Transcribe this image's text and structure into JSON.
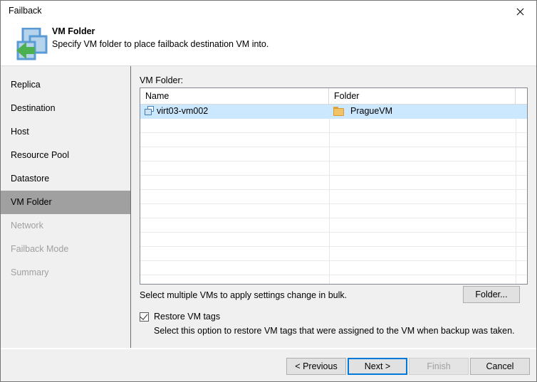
{
  "window": {
    "title": "Failback",
    "close_icon": "close-icon"
  },
  "header": {
    "icon": "failback-vm-folder-icon",
    "title": "VM Folder",
    "subtitle": "Specify VM folder to place failback destination VM into."
  },
  "sidebar": {
    "items": [
      {
        "label": "Replica",
        "state": "enabled"
      },
      {
        "label": "Destination",
        "state": "enabled"
      },
      {
        "label": "Host",
        "state": "enabled"
      },
      {
        "label": "Resource Pool",
        "state": "enabled"
      },
      {
        "label": "Datastore",
        "state": "enabled"
      },
      {
        "label": "VM Folder",
        "state": "selected"
      },
      {
        "label": "Network",
        "state": "disabled"
      },
      {
        "label": "Failback Mode",
        "state": "disabled"
      },
      {
        "label": "Summary",
        "state": "disabled"
      }
    ]
  },
  "main": {
    "list_label": "VM Folder:",
    "grid": {
      "columns": [
        "Name",
        "Folder"
      ],
      "rows": [
        {
          "name": "virt03-vm002",
          "folder": "PragueVM",
          "selected": true
        }
      ],
      "empty_row_count": 12
    },
    "hint": "Select multiple VMs to apply settings change in bulk.",
    "folder_button": "Folder...",
    "checkbox": {
      "label": "Restore VM tags",
      "checked": true,
      "description": "Select this option to restore VM tags that were assigned to the VM when backup was taken."
    }
  },
  "footer": {
    "previous": "< Previous",
    "next": "Next >",
    "finish": "Finish",
    "cancel": "Cancel"
  },
  "colors": {
    "selection_blue": "#cce8ff",
    "focus_blue": "#0078d7",
    "sidebar_selected": "#a0a0a0",
    "panel_gray": "#f0f0f0",
    "disabled_text": "#a0a0a0",
    "folder_yellow": "#f2c268",
    "vm_blue": "#3f7fbf",
    "arrow_green": "#4caf50"
  }
}
